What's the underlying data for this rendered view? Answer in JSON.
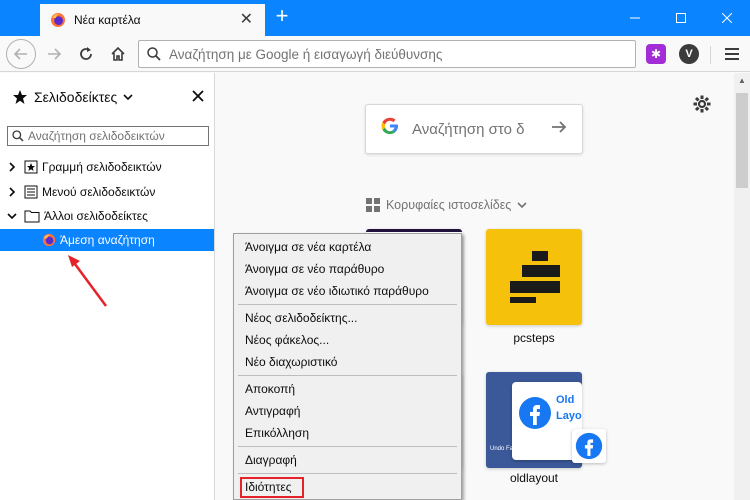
{
  "tab": {
    "title": "Νέα καρτέλα",
    "close": "✕",
    "new_tab": "+"
  },
  "window": {
    "minimize": "—",
    "maximize": "☐",
    "close": "✕"
  },
  "navbar": {
    "search_placeholder": "Αναζήτηση με Google ή εισαγωγή διεύθυνσης",
    "ext_profile_label": "V"
  },
  "sidebar": {
    "title": "Σελιδοδείκτες",
    "search_placeholder": "Αναζήτηση σελιδοδεικτών",
    "items": [
      {
        "label": "Γραμμή σελιδοδεικτών",
        "expanded": false
      },
      {
        "label": "Μενού σελιδοδεικτών",
        "expanded": false
      },
      {
        "label": "Άλλοι σελιδοδείκτες",
        "expanded": true
      },
      {
        "label": "Άμεση αναζήτηση",
        "selected": true
      }
    ]
  },
  "newtab": {
    "google_search": "Αναζήτηση στο δ",
    "top_sites_title": "Κορυφαίες ιστοσελίδες",
    "tiles": [
      {
        "label": "pcsteps"
      },
      {
        "label": "oldlayout",
        "thumb_line1": "Old",
        "thumb_line2": "Layo",
        "thumb_small": "Undo Facebook's..."
      }
    ]
  },
  "context_menu": {
    "groups": [
      [
        "Άνοιγμα σε νέα καρτέλα",
        "Άνοιγμα σε νέο παράθυρο",
        "Άνοιγμα σε νέο ιδιωτικό παράθυρο"
      ],
      [
        "Νέος σελιδοδείκτης...",
        "Νέος φάκελος...",
        "Νέο διαχωριστικό"
      ],
      [
        "Αποκοπή",
        "Αντιγραφή",
        "Επικόλληση"
      ],
      [
        "Διαγραφή"
      ],
      [
        "Ιδιότητες"
      ]
    ]
  },
  "colors": {
    "accent": "#0a84ff",
    "highlight_box": "#e4232b",
    "pcsteps_bg": "#f6c10b",
    "facebook_blue": "#1877f2"
  }
}
